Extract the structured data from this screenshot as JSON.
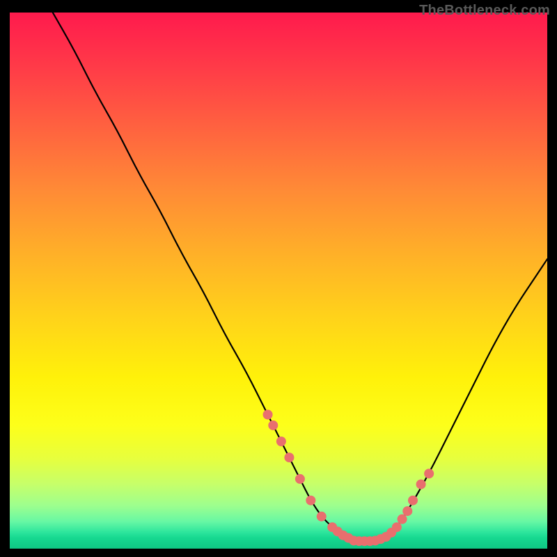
{
  "watermark": "TheBottleneck.com",
  "colors": {
    "background": "#000000",
    "curve_stroke": "#000000",
    "marker_fill": "#e96f6e",
    "watermark_text": "#5a5a5a"
  },
  "chart_data": {
    "type": "line",
    "title": "",
    "xlabel": "",
    "ylabel": "",
    "xlim": [
      0,
      100
    ],
    "ylim": [
      0,
      100
    ],
    "grid": false,
    "legend": false,
    "series": [
      {
        "name": "bottleneck-curve",
        "x": [
          8,
          12,
          16,
          20,
          24,
          28,
          32,
          36,
          40,
          44,
          48,
          50,
          52,
          54,
          56,
          58,
          60,
          62,
          64,
          66,
          68,
          70,
          72,
          74,
          78,
          82,
          86,
          90,
          94,
          98,
          100
        ],
        "y": [
          100,
          93,
          85,
          78,
          70,
          63,
          55,
          48,
          40,
          33,
          25,
          21,
          17,
          13,
          9,
          6,
          4,
          2.5,
          1.5,
          1.4,
          1.5,
          2.2,
          4,
          7,
          14,
          22,
          30,
          38,
          45,
          51,
          54
        ]
      }
    ],
    "markers": {
      "note": "dots rendered along the curve near the valley",
      "x": [
        48,
        49,
        50.5,
        52,
        54,
        56,
        58,
        60,
        61,
        62,
        63,
        64,
        65,
        66,
        67,
        68,
        69,
        70,
        71,
        72,
        73,
        74,
        75,
        76.5,
        78
      ],
      "y": [
        25,
        23,
        20,
        17,
        13,
        9,
        6,
        4,
        3.2,
        2.5,
        2,
        1.5,
        1.4,
        1.4,
        1.4,
        1.5,
        1.8,
        2.2,
        3,
        4,
        5.5,
        7,
        9,
        12,
        14
      ]
    },
    "gradient_stops": [
      {
        "pct": 0,
        "color": "#ff1a4d"
      },
      {
        "pct": 10,
        "color": "#ff3a48"
      },
      {
        "pct": 22,
        "color": "#ff643f"
      },
      {
        "pct": 33,
        "color": "#ff8a36"
      },
      {
        "pct": 45,
        "color": "#ffb028"
      },
      {
        "pct": 57,
        "color": "#ffd31a"
      },
      {
        "pct": 68,
        "color": "#fff10a"
      },
      {
        "pct": 77,
        "color": "#fdff1a"
      },
      {
        "pct": 83,
        "color": "#e8ff3c"
      },
      {
        "pct": 88,
        "color": "#c6ff6a"
      },
      {
        "pct": 92,
        "color": "#9dff8e"
      },
      {
        "pct": 95,
        "color": "#66f7a4"
      },
      {
        "pct": 97,
        "color": "#2be59c"
      },
      {
        "pct": 98,
        "color": "#16d890"
      },
      {
        "pct": 100,
        "color": "#0fc784"
      }
    ]
  }
}
